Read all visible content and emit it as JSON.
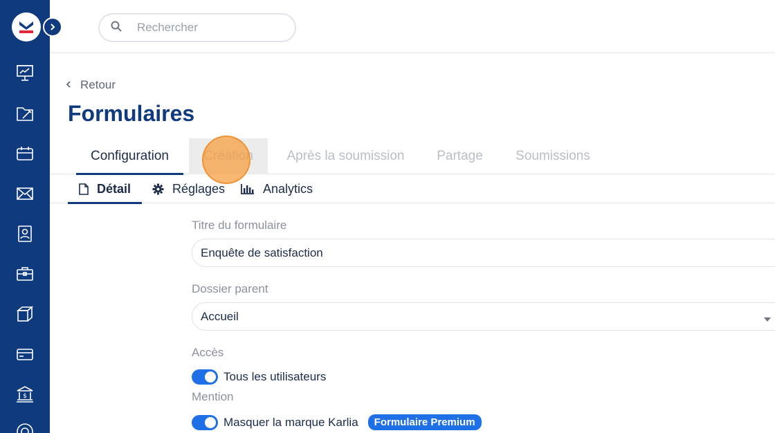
{
  "sidebar": {
    "logo_icon": "karlia-logo-icon",
    "expand_icon": "chevron-right-icon",
    "items": [
      {
        "icon": "presentation-icon"
      },
      {
        "icon": "folder-edit-icon"
      },
      {
        "icon": "calendar-icon"
      },
      {
        "icon": "mail-icon"
      },
      {
        "icon": "contact-card-icon"
      },
      {
        "icon": "briefcase-icon"
      },
      {
        "icon": "box-icon"
      },
      {
        "icon": "credit-card-icon"
      },
      {
        "icon": "bank-icon"
      },
      {
        "icon": "support-icon"
      }
    ]
  },
  "search": {
    "placeholder": "Rechercher"
  },
  "header": {
    "back_label": "Retour",
    "title": "Formulaires"
  },
  "tabs": [
    {
      "label": "Configuration",
      "active": true
    },
    {
      "label": "Création",
      "hover": true
    },
    {
      "label": "Après la soumission"
    },
    {
      "label": "Partage"
    },
    {
      "label": "Soumissions"
    }
  ],
  "subtabs": [
    {
      "label": "Détail",
      "icon": "document-icon",
      "active": true
    },
    {
      "label": "Réglages",
      "icon": "gear-icon"
    },
    {
      "label": "Analytics",
      "icon": "bar-chart-icon"
    }
  ],
  "form": {
    "title_label": "Titre du formulaire",
    "title_value": "Enquête de satisfaction",
    "parent_label": "Dossier parent",
    "parent_value": "Accueil",
    "access_label": "Accès",
    "access_toggle_label": "Tous les utilisateurs",
    "access_toggle_on": true,
    "mention_label": "Mention",
    "mention_toggle_label": "Masquer la marque Karlia",
    "mention_toggle_on": true,
    "premium_badge": "Formulaire Premium"
  },
  "colors": {
    "sidebar": "#0f3a7d",
    "primary": "#0f3a7d",
    "toggle": "#1f6fe6",
    "click_marker": "#f79c3c"
  }
}
